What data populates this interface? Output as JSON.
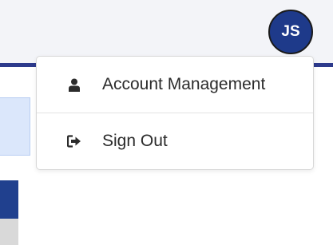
{
  "header": {
    "avatar_initials": "JS"
  },
  "user_menu": {
    "items": [
      {
        "label": "Account Management",
        "icon": "user-icon"
      },
      {
        "label": "Sign Out",
        "icon": "sign-out-icon"
      }
    ]
  },
  "colors": {
    "header_background": "#f3f4f8",
    "header_accent": "#2d3a8c",
    "avatar_background": "#1e3a8a",
    "panel_highlight": "#dbe7fb",
    "nav_active": "#20408e"
  }
}
